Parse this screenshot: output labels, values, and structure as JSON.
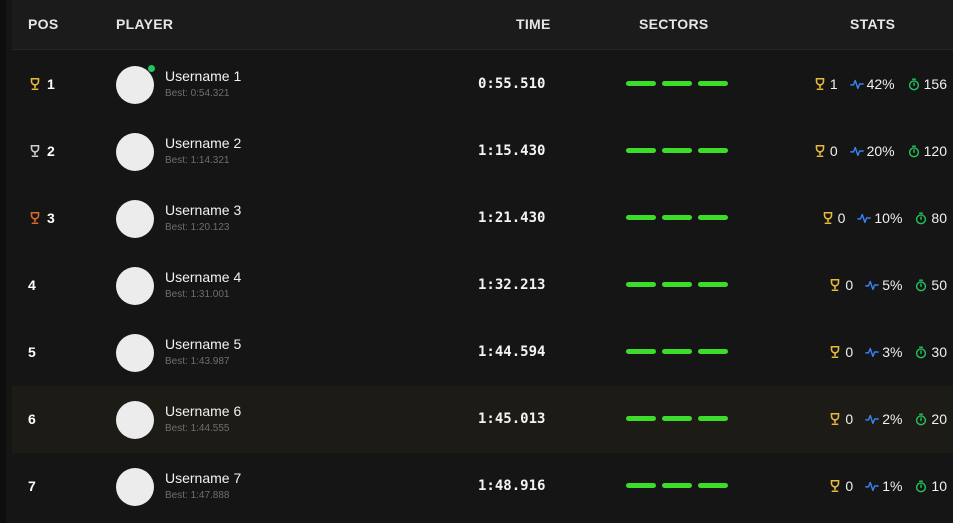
{
  "header": {
    "pos": "POS",
    "player": "PLAYER",
    "time": "TIME",
    "sectors": "SECTORS",
    "stats": "STATS"
  },
  "colors": {
    "gold": "#e8b93a",
    "silver": "#cfcfcf",
    "bronze": "#d86a2c",
    "sector_green": "#3ddc2a",
    "stat_blue": "#3b82f6",
    "stat_green": "#22c55e",
    "online": "#22c55e"
  },
  "rows": [
    {
      "pos": "1",
      "trophy": "gold",
      "name": "Username 1",
      "best": "Best: 0:54.321",
      "time": "0:55.510",
      "wins": "1",
      "rate": "42%",
      "laps": "156",
      "online": true
    },
    {
      "pos": "2",
      "trophy": "silver",
      "name": "Username 2",
      "best": "Best: 1:14.321",
      "time": "1:15.430",
      "wins": "0",
      "rate": "20%",
      "laps": "120"
    },
    {
      "pos": "3",
      "trophy": "bronze",
      "name": "Username 3",
      "best": "Best: 1:20.123",
      "time": "1:21.430",
      "wins": "0",
      "rate": "10%",
      "laps": "80"
    },
    {
      "pos": "4",
      "name": "Username 4",
      "best": "Best: 1:31.001",
      "time": "1:32.213",
      "wins": "0",
      "rate": "5%",
      "laps": "50"
    },
    {
      "pos": "5",
      "name": "Username 5",
      "best": "Best: 1:43.987",
      "time": "1:44.594",
      "wins": "0",
      "rate": "3%",
      "laps": "30"
    },
    {
      "pos": "6",
      "name": "Username 6",
      "best": "Best: 1:44.555",
      "time": "1:45.013",
      "wins": "0",
      "rate": "2%",
      "laps": "20",
      "highlight": true
    },
    {
      "pos": "7",
      "name": "Username 7",
      "best": "Best: 1:47.888",
      "time": "1:48.916",
      "wins": "0",
      "rate": "1%",
      "laps": "10"
    }
  ]
}
